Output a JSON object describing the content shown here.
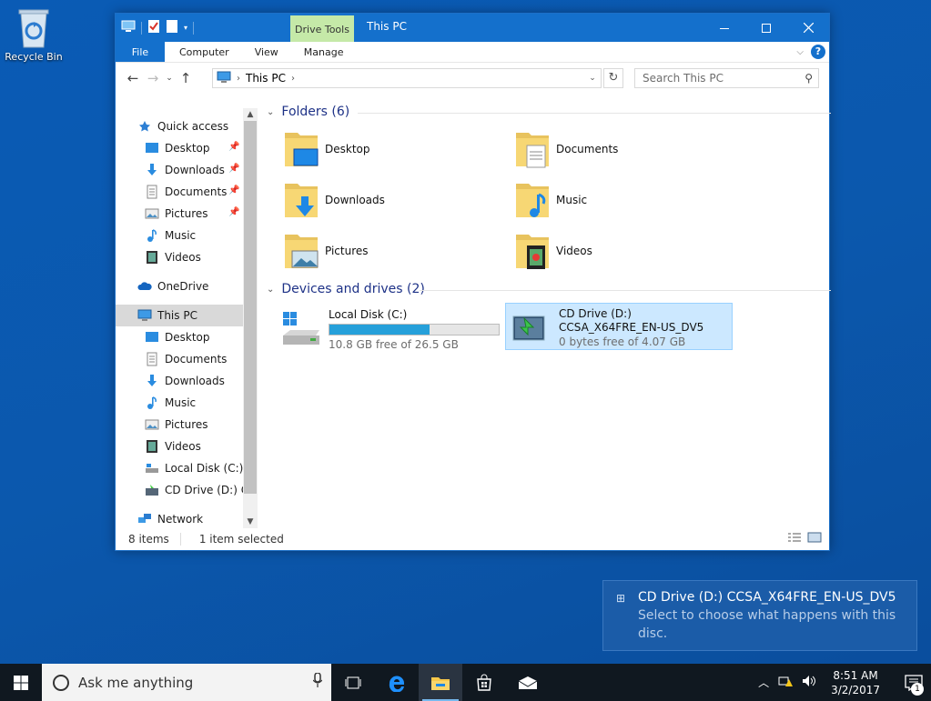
{
  "desktop": {
    "recycle_bin_label": "Recycle Bin"
  },
  "window": {
    "title": "This PC",
    "context_tab": "Drive Tools",
    "ribbon_tabs": [
      "File",
      "Computer",
      "View",
      "Manage"
    ],
    "breadcrumb": "This PC",
    "search_placeholder": "Search This PC",
    "colors": {
      "accent": "#1470cc",
      "context_tab_bg": "#c5e9a8",
      "selection": "#cce8ff"
    }
  },
  "nav": {
    "quick_access": "Quick access",
    "quick_items": [
      "Desktop",
      "Downloads",
      "Documents",
      "Pictures",
      "Music",
      "Videos"
    ],
    "onedrive": "OneDrive",
    "this_pc": "This PC",
    "pc_items": [
      "Desktop",
      "Documents",
      "Downloads",
      "Music",
      "Pictures",
      "Videos",
      "Local Disk (C:)",
      "CD Drive (D:) CC"
    ],
    "network": "Network"
  },
  "content": {
    "folders_header": "Folders (6)",
    "folders": [
      "Desktop",
      "Documents",
      "Downloads",
      "Music",
      "Pictures",
      "Videos"
    ],
    "devices_header": "Devices and drives (2)",
    "drives": [
      {
        "name": "Local Disk (C:)",
        "free": "10.8 GB free of 26.5 GB",
        "used_fraction": 0.59
      },
      {
        "name": "CD Drive (D:)",
        "label": "CCSA_X64FRE_EN-US_DV5",
        "free": "0 bytes free of 4.07 GB"
      }
    ]
  },
  "status": {
    "items": "8 items",
    "selected": "1 item selected"
  },
  "toast": {
    "title": "CD Drive (D:) CCSA_X64FRE_EN-US_DV5",
    "body": "Select to choose what happens with this disc."
  },
  "taskbar": {
    "search_placeholder": "Ask me anything",
    "time": "8:51 AM",
    "date": "3/2/2017",
    "notification_count": "1"
  }
}
